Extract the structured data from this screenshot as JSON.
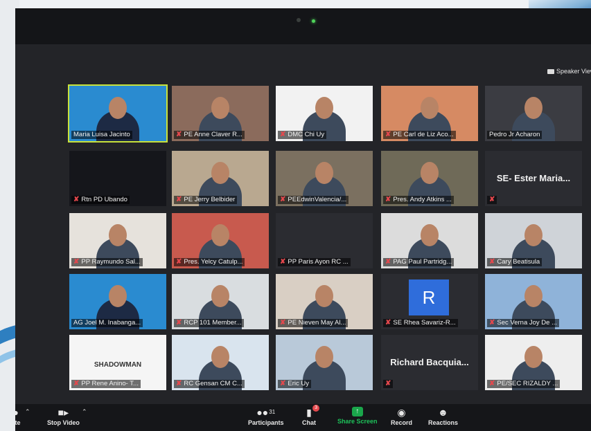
{
  "header": {
    "view_mode_label": "Speaker View"
  },
  "tiles": [
    {
      "name": "Maria Luisa Jacinto",
      "muted": false,
      "active": true,
      "bg": "#2a8bd0",
      "kind": "rotary"
    },
    {
      "name": "PE Anne Claver R...",
      "muted": true,
      "bg": "#8b6b5c",
      "kind": "person"
    },
    {
      "name": "DMC Chi Uy",
      "muted": true,
      "bg": "#f2f2f2",
      "kind": "person"
    },
    {
      "name": "PE Carl de Liz Aco...",
      "muted": true,
      "bg": "#d68a63",
      "kind": "person"
    },
    {
      "name": "Pedro Jr Acharon",
      "muted": false,
      "bg": "#3b3c42",
      "kind": "person"
    },
    {
      "name": "Rtn PD Ubando",
      "muted": true,
      "bg": "#15161b",
      "kind": "dark"
    },
    {
      "name": "PE Jerry Belbider",
      "muted": true,
      "bg": "#b9a890",
      "kind": "person"
    },
    {
      "name": "PEEdwinValencia/...",
      "muted": true,
      "bg": "#7b7060",
      "kind": "person"
    },
    {
      "name": "Pres. Andy Atkins ...",
      "muted": true,
      "bg": "#6f6a58",
      "kind": "person"
    },
    {
      "name": "",
      "muted": true,
      "bg": "#2b2c31",
      "kind": "text",
      "big": "SE- Ester Maria..."
    },
    {
      "name": "PP Raymundo Sal...",
      "muted": true,
      "bg": "#e6e2dc",
      "kind": "person"
    },
    {
      "name": "Pres. Yelcy Catulp...",
      "muted": true,
      "bg": "#c85a4e",
      "kind": "person"
    },
    {
      "name": "PP Paris Ayon RC ...",
      "muted": true,
      "bg": "#2b2c31",
      "kind": "none"
    },
    {
      "name": "PAG Paul Partridg...",
      "muted": true,
      "bg": "#dcdcdc",
      "kind": "person"
    },
    {
      "name": "Cary Beatisula",
      "muted": true,
      "bg": "#cfd3d8",
      "kind": "person"
    },
    {
      "name": "AG Joel M. Inabanga...",
      "muted": false,
      "bg": "#2a8bd0",
      "kind": "rotary"
    },
    {
      "name": "RCP 101 Member...",
      "muted": true,
      "bg": "#d9dde0",
      "kind": "person"
    },
    {
      "name": "PE Nieven May Al...",
      "muted": true,
      "bg": "#d9cfc4",
      "kind": "person"
    },
    {
      "name": "SE Rhea Savariz-R...",
      "muted": true,
      "bg": "#2b2c31",
      "kind": "initial",
      "initial": "R"
    },
    {
      "name": "Sec Verna Joy De ...",
      "muted": true,
      "bg": "#8fb3d9",
      "kind": "person"
    },
    {
      "name": "PP Rene Anino- T...",
      "muted": true,
      "bg": "#f5f5f5",
      "kind": "logo",
      "logo": "SHADOWMAN"
    },
    {
      "name": "RC Gensan CM C...",
      "muted": true,
      "bg": "#d9e4ee",
      "kind": "person"
    },
    {
      "name": "Eric Uy",
      "muted": true,
      "bg": "#b9c9d9",
      "kind": "person"
    },
    {
      "name": "",
      "muted": true,
      "bg": "#2b2c31",
      "kind": "text",
      "big": "Richard  Bacquia..."
    },
    {
      "name": "PE/SEC RIZALDY ...",
      "muted": true,
      "bg": "#eeeeee",
      "kind": "person"
    }
  ],
  "toolbar": {
    "mute_label": "ute",
    "stop_video_label": "Stop Video",
    "participants_label": "Participants",
    "participants_count": "31",
    "chat_label": "Chat",
    "chat_badge": "3",
    "share_label": "Share Screen",
    "record_label": "Record",
    "reactions_label": "Reactions"
  },
  "colors": {
    "accent_active": "#c9e23a",
    "share_green": "#1dc35a",
    "muted_red": "#e5484d"
  },
  "icons": {
    "view": "grid-icon",
    "video": "video-camera-icon",
    "participants": "people-icon",
    "chat": "chat-bubble-icon",
    "share": "share-arrow-icon",
    "record": "record-icon",
    "reactions": "smiley-icon",
    "mute": "mic-muted-icon"
  }
}
